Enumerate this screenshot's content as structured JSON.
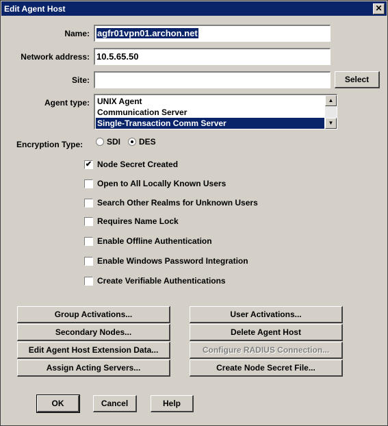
{
  "window": {
    "title": "Edit Agent Host",
    "close_glyph": "✕"
  },
  "fields": {
    "name_label": "Name:",
    "name_value": "agfr01vpn01.archon.net",
    "network_label": "Network address:",
    "network_value": "10.5.65.50",
    "site_label": "Site:",
    "site_value": "",
    "select_button": "Select"
  },
  "agent_type": {
    "label": "Agent type:",
    "options": [
      "UNIX Agent",
      "Communication Server",
      "Single-Transaction Comm Server"
    ],
    "selected": "Single-Transaction Comm Server"
  },
  "encryption": {
    "label": "Encryption Type:",
    "option_sdi": "SDI",
    "option_des": "DES",
    "selected": "DES"
  },
  "checkboxes": [
    {
      "label": "Node Secret Created",
      "checked": true
    },
    {
      "label": "Open to All Locally Known Users",
      "checked": false
    },
    {
      "label": "Search Other Realms for Unknown Users",
      "checked": false
    },
    {
      "label": "Requires Name Lock",
      "checked": false
    },
    {
      "label": "Enable Offline Authentication",
      "checked": false
    },
    {
      "label": "Enable Windows Password Integration",
      "checked": false
    },
    {
      "label": "Create Verifiable Authentications",
      "checked": false
    }
  ],
  "action_buttons": {
    "group_activations": "Group Activations...",
    "user_activations": "User Activations...",
    "secondary_nodes": "Secondary Nodes...",
    "delete_agent_host": "Delete Agent Host",
    "edit_extension_data": "Edit Agent Host Extension Data...",
    "configure_radius": "Configure RADIUS Connection...",
    "assign_acting_servers": "Assign Acting Servers...",
    "create_node_secret": "Create Node Secret File..."
  },
  "footer": {
    "ok": "OK",
    "cancel": "Cancel",
    "help": "Help"
  },
  "icons": {
    "check": "✔",
    "scroll_up": "▲",
    "scroll_down": "▼"
  },
  "colors": {
    "face": "#d4d0c8",
    "title_bar": "#0a246a",
    "selection": "#0a246a"
  }
}
